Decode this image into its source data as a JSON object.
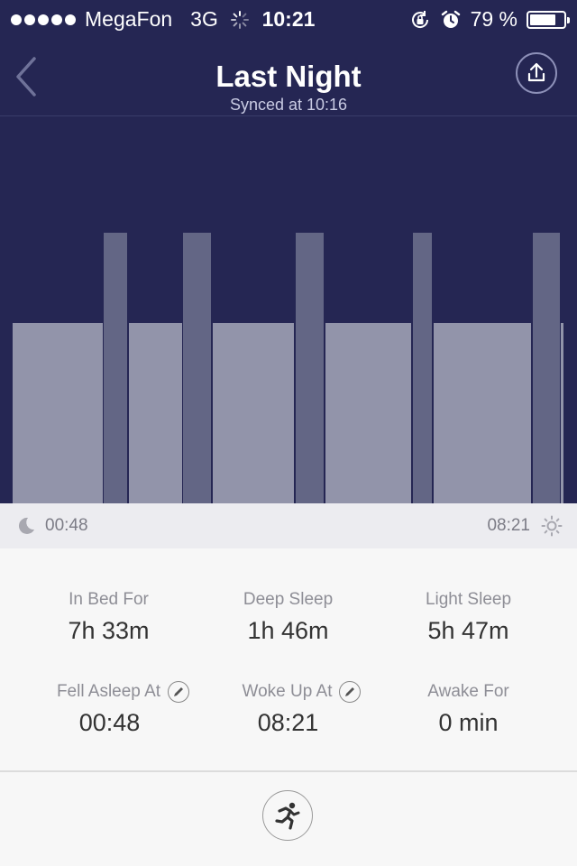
{
  "status_bar": {
    "signal_dots": 5,
    "carrier": "MegaFon",
    "network": "3G",
    "time": "10:21",
    "battery_text": "79 %",
    "battery_level": 0.79
  },
  "nav": {
    "title": "Last Night",
    "subtitle": "Synced at 10:16",
    "back_icon": "chevron-left-icon",
    "share_icon": "upload-icon"
  },
  "chart_data": {
    "type": "bar",
    "segments": [
      {
        "kind": "light",
        "start": 0.022,
        "end": 0.178
      },
      {
        "kind": "deep",
        "start": 0.18,
        "end": 0.22
      },
      {
        "kind": "light",
        "start": 0.223,
        "end": 0.315
      },
      {
        "kind": "deep",
        "start": 0.317,
        "end": 0.366
      },
      {
        "kind": "light",
        "start": 0.369,
        "end": 0.509
      },
      {
        "kind": "deep",
        "start": 0.512,
        "end": 0.561
      },
      {
        "kind": "light",
        "start": 0.564,
        "end": 0.712
      },
      {
        "kind": "deep",
        "start": 0.715,
        "end": 0.749
      },
      {
        "kind": "light",
        "start": 0.752,
        "end": 0.92
      },
      {
        "kind": "deep",
        "start": 0.923,
        "end": 0.97
      },
      {
        "kind": "light",
        "start": 0.972,
        "end": 0.977
      }
    ],
    "levels": {
      "light": 0.465,
      "deep": 0.698
    },
    "colors": {
      "light": "#9294aa",
      "deep": "#636685",
      "background": "#252653"
    }
  },
  "timeline": {
    "start": "00:48",
    "end": "08:21"
  },
  "stats": [
    {
      "label": "In Bed For",
      "value": "7h 33m",
      "editable": false
    },
    {
      "label": "Deep Sleep",
      "value": "1h 46m",
      "editable": false
    },
    {
      "label": "Light Sleep",
      "value": "5h 47m",
      "editable": false
    },
    {
      "label": "Fell Asleep At",
      "value": "00:48",
      "editable": true
    },
    {
      "label": "Woke Up At",
      "value": "08:21",
      "editable": true
    },
    {
      "label": "Awake For",
      "value": "0 min",
      "editable": false
    }
  ],
  "bottom": {
    "activity_icon": "running-icon"
  }
}
